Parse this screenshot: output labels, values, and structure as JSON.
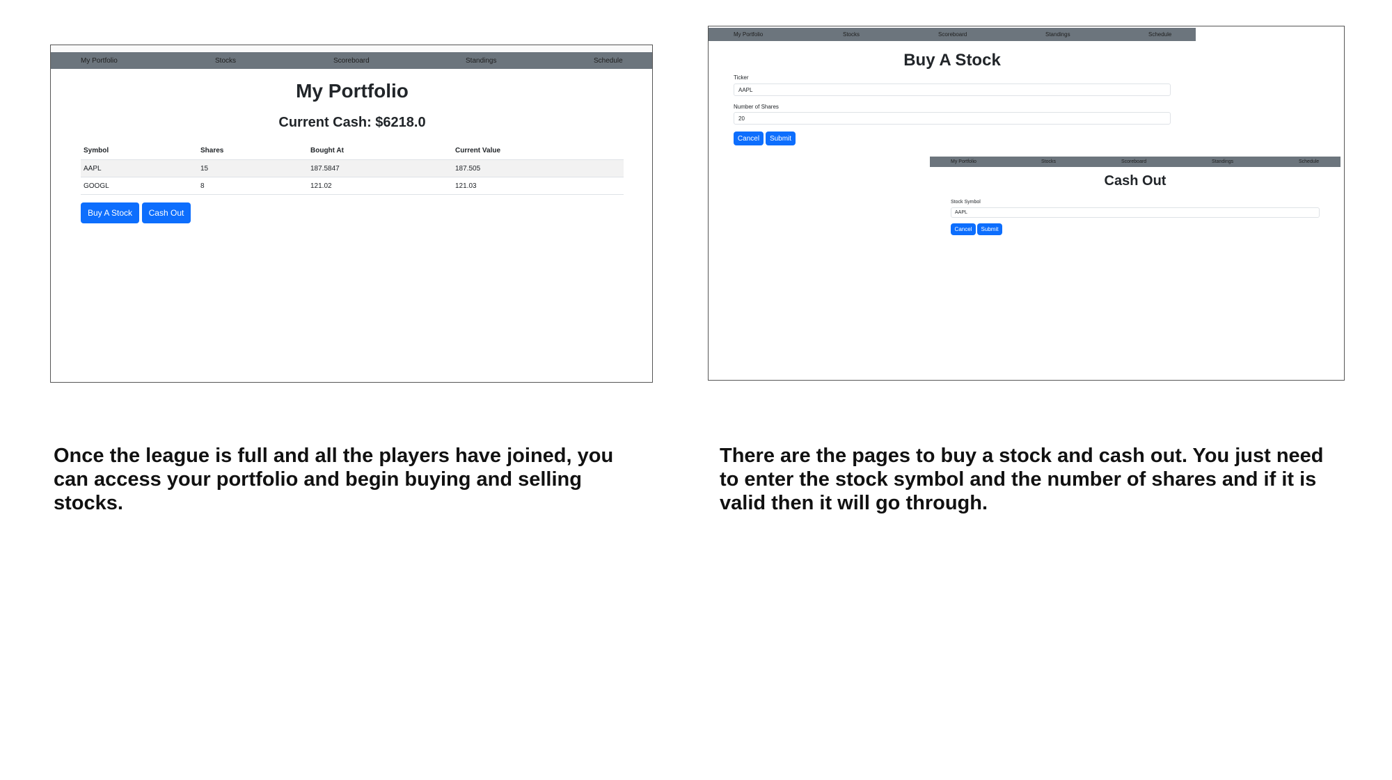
{
  "nav": [
    "My Portfolio",
    "Stocks",
    "Scoreboard",
    "Standings",
    "Schedule"
  ],
  "portfolio": {
    "title": "My Portfolio",
    "cash": "Current Cash: $6218.0",
    "columns": [
      "Symbol",
      "Shares",
      "Bought At",
      "Current Value"
    ],
    "rows": [
      [
        "AAPL",
        "15",
        "187.5847",
        "187.505"
      ],
      [
        "GOOGL",
        "8",
        "121.02",
        "121.03"
      ]
    ],
    "buy_label": "Buy A Stock",
    "cashout_label": "Cash Out"
  },
  "buy": {
    "title": "Buy A Stock",
    "ticker_label": "Ticker",
    "ticker_value": "AAPL",
    "shares_label": "Number of Shares",
    "shares_value": "20",
    "cancel": "Cancel",
    "submit": "Submit"
  },
  "cashout": {
    "title": "Cash Out",
    "symbol_label": "Stock Symbol",
    "symbol_value": "AAPL",
    "cancel": "Cancel",
    "submit": "Submit"
  },
  "captions": {
    "left": "Once the league is full and all the players have joined, you can access your portfolio and begin buying and selling stocks.",
    "right": "There are the pages to buy a stock and cash out. You just need to enter the stock symbol and the number of shares and if it is valid then it will go through."
  },
  "colors": {
    "navbar": "#6c757d",
    "button": "#0d6efd",
    "stripe": "#f2f2f2"
  }
}
